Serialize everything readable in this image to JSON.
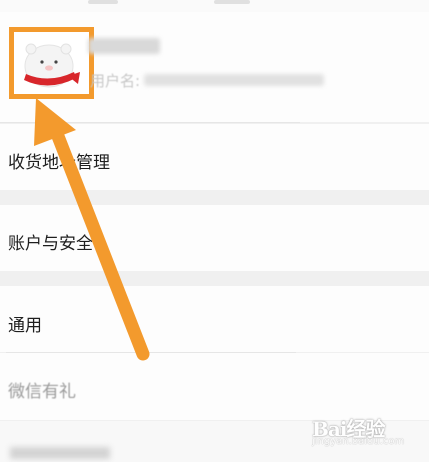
{
  "profile": {
    "username_label": "用户名:"
  },
  "menu": {
    "address": "收货地址管理",
    "account": "账户与安全",
    "general": "通用",
    "gift": "微信有礼"
  },
  "watermark": {
    "logo": "Bai经验",
    "sub": "jingyan.baidu.com"
  },
  "colors": {
    "annotation_orange": "#f39a2d",
    "avatar_scarf": "#d8262b"
  }
}
